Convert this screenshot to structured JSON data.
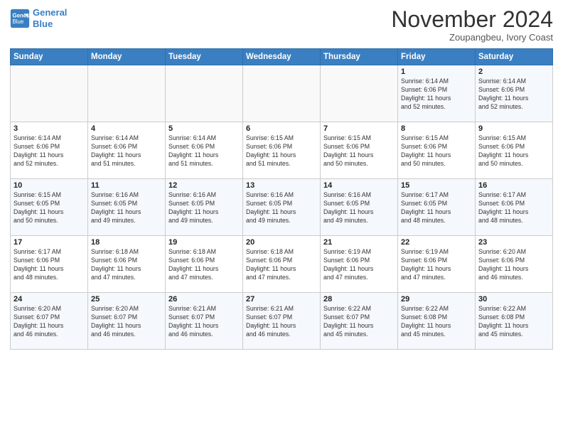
{
  "header": {
    "logo_line1": "General",
    "logo_line2": "Blue",
    "month": "November 2024",
    "location": "Zoupangbeu, Ivory Coast"
  },
  "weekdays": [
    "Sunday",
    "Monday",
    "Tuesday",
    "Wednesday",
    "Thursday",
    "Friday",
    "Saturday"
  ],
  "weeks": [
    [
      {
        "day": "",
        "info": ""
      },
      {
        "day": "",
        "info": ""
      },
      {
        "day": "",
        "info": ""
      },
      {
        "day": "",
        "info": ""
      },
      {
        "day": "",
        "info": ""
      },
      {
        "day": "1",
        "info": "Sunrise: 6:14 AM\nSunset: 6:06 PM\nDaylight: 11 hours\nand 52 minutes."
      },
      {
        "day": "2",
        "info": "Sunrise: 6:14 AM\nSunset: 6:06 PM\nDaylight: 11 hours\nand 52 minutes."
      }
    ],
    [
      {
        "day": "3",
        "info": "Sunrise: 6:14 AM\nSunset: 6:06 PM\nDaylight: 11 hours\nand 52 minutes."
      },
      {
        "day": "4",
        "info": "Sunrise: 6:14 AM\nSunset: 6:06 PM\nDaylight: 11 hours\nand 51 minutes."
      },
      {
        "day": "5",
        "info": "Sunrise: 6:14 AM\nSunset: 6:06 PM\nDaylight: 11 hours\nand 51 minutes."
      },
      {
        "day": "6",
        "info": "Sunrise: 6:15 AM\nSunset: 6:06 PM\nDaylight: 11 hours\nand 51 minutes."
      },
      {
        "day": "7",
        "info": "Sunrise: 6:15 AM\nSunset: 6:06 PM\nDaylight: 11 hours\nand 50 minutes."
      },
      {
        "day": "8",
        "info": "Sunrise: 6:15 AM\nSunset: 6:06 PM\nDaylight: 11 hours\nand 50 minutes."
      },
      {
        "day": "9",
        "info": "Sunrise: 6:15 AM\nSunset: 6:06 PM\nDaylight: 11 hours\nand 50 minutes."
      }
    ],
    [
      {
        "day": "10",
        "info": "Sunrise: 6:15 AM\nSunset: 6:05 PM\nDaylight: 11 hours\nand 50 minutes."
      },
      {
        "day": "11",
        "info": "Sunrise: 6:16 AM\nSunset: 6:05 PM\nDaylight: 11 hours\nand 49 minutes."
      },
      {
        "day": "12",
        "info": "Sunrise: 6:16 AM\nSunset: 6:05 PM\nDaylight: 11 hours\nand 49 minutes."
      },
      {
        "day": "13",
        "info": "Sunrise: 6:16 AM\nSunset: 6:05 PM\nDaylight: 11 hours\nand 49 minutes."
      },
      {
        "day": "14",
        "info": "Sunrise: 6:16 AM\nSunset: 6:05 PM\nDaylight: 11 hours\nand 49 minutes."
      },
      {
        "day": "15",
        "info": "Sunrise: 6:17 AM\nSunset: 6:05 PM\nDaylight: 11 hours\nand 48 minutes."
      },
      {
        "day": "16",
        "info": "Sunrise: 6:17 AM\nSunset: 6:06 PM\nDaylight: 11 hours\nand 48 minutes."
      }
    ],
    [
      {
        "day": "17",
        "info": "Sunrise: 6:17 AM\nSunset: 6:06 PM\nDaylight: 11 hours\nand 48 minutes."
      },
      {
        "day": "18",
        "info": "Sunrise: 6:18 AM\nSunset: 6:06 PM\nDaylight: 11 hours\nand 47 minutes."
      },
      {
        "day": "19",
        "info": "Sunrise: 6:18 AM\nSunset: 6:06 PM\nDaylight: 11 hours\nand 47 minutes."
      },
      {
        "day": "20",
        "info": "Sunrise: 6:18 AM\nSunset: 6:06 PM\nDaylight: 11 hours\nand 47 minutes."
      },
      {
        "day": "21",
        "info": "Sunrise: 6:19 AM\nSunset: 6:06 PM\nDaylight: 11 hours\nand 47 minutes."
      },
      {
        "day": "22",
        "info": "Sunrise: 6:19 AM\nSunset: 6:06 PM\nDaylight: 11 hours\nand 47 minutes."
      },
      {
        "day": "23",
        "info": "Sunrise: 6:20 AM\nSunset: 6:06 PM\nDaylight: 11 hours\nand 46 minutes."
      }
    ],
    [
      {
        "day": "24",
        "info": "Sunrise: 6:20 AM\nSunset: 6:07 PM\nDaylight: 11 hours\nand 46 minutes."
      },
      {
        "day": "25",
        "info": "Sunrise: 6:20 AM\nSunset: 6:07 PM\nDaylight: 11 hours\nand 46 minutes."
      },
      {
        "day": "26",
        "info": "Sunrise: 6:21 AM\nSunset: 6:07 PM\nDaylight: 11 hours\nand 46 minutes."
      },
      {
        "day": "27",
        "info": "Sunrise: 6:21 AM\nSunset: 6:07 PM\nDaylight: 11 hours\nand 46 minutes."
      },
      {
        "day": "28",
        "info": "Sunrise: 6:22 AM\nSunset: 6:07 PM\nDaylight: 11 hours\nand 45 minutes."
      },
      {
        "day": "29",
        "info": "Sunrise: 6:22 AM\nSunset: 6:08 PM\nDaylight: 11 hours\nand 45 minutes."
      },
      {
        "day": "30",
        "info": "Sunrise: 6:22 AM\nSunset: 6:08 PM\nDaylight: 11 hours\nand 45 minutes."
      }
    ]
  ]
}
